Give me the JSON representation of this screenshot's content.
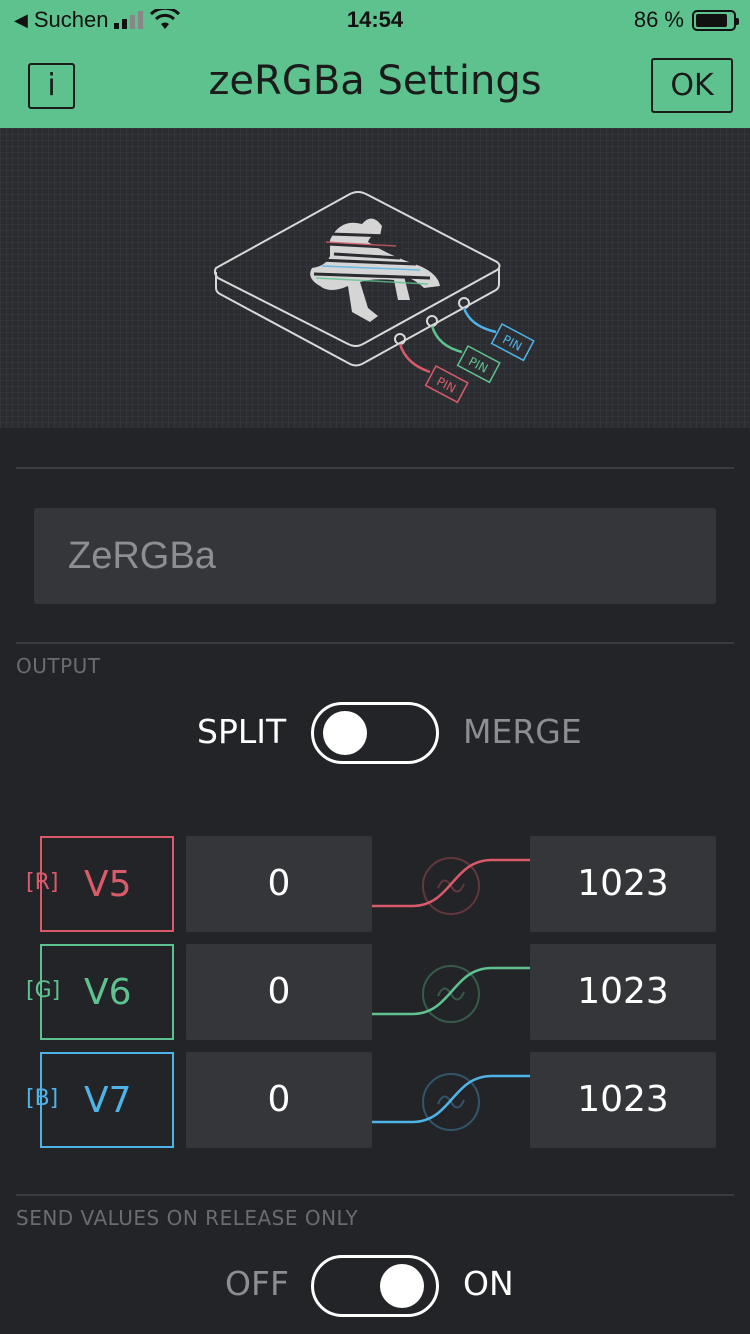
{
  "status_bar": {
    "back_label": "Suchen",
    "time": "14:54",
    "battery": "86 %",
    "battery_level": 0.86
  },
  "header": {
    "title": "zeRGBa Settings",
    "info_label": "i",
    "ok_label": "OK"
  },
  "illustration": {
    "pin_labels": [
      "PIN",
      "PIN",
      "PIN"
    ]
  },
  "name_field": {
    "value": "ZeRGBa"
  },
  "output": {
    "label": "OUTPUT",
    "left_label": "SPLIT",
    "right_label": "MERGE",
    "state": "split"
  },
  "channels": [
    {
      "tag": "[R]",
      "pin": "V5",
      "min": "0",
      "max": "1023",
      "color": "#d95b6a"
    },
    {
      "tag": "[G]",
      "pin": "V6",
      "min": "0",
      "max": "1023",
      "color": "#5ec28f"
    },
    {
      "tag": "[B]",
      "pin": "V7",
      "min": "0",
      "max": "1023",
      "color": "#4fb3e8"
    }
  ],
  "release": {
    "label": "SEND VALUES ON RELEASE ONLY",
    "off_label": "OFF",
    "on_label": "ON",
    "state": "on"
  },
  "colors": {
    "accent": "#5ec28f",
    "background": "#232427",
    "field": "#35363a"
  }
}
